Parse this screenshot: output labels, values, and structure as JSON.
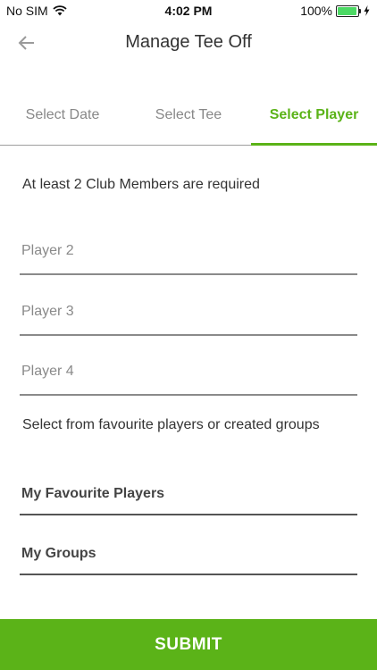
{
  "status_bar": {
    "carrier": "No SIM",
    "time": "4:02 PM",
    "battery": "100%",
    "battery_color": "#4cd964"
  },
  "nav": {
    "title": "Manage Tee Off",
    "back_icon": "arrow-left-icon"
  },
  "tabs": [
    {
      "label": "Select Date",
      "active": false
    },
    {
      "label": "Select Tee",
      "active": false
    },
    {
      "label": "Select Player",
      "active": true
    }
  ],
  "form": {
    "requirement_text": "At least 2 Club Members are required",
    "players": [
      {
        "placeholder": "Player 2"
      },
      {
        "placeholder": "Player 3"
      },
      {
        "placeholder": "Player 4"
      }
    ],
    "favourites_text": "Select from favourite players or created groups",
    "selectors": [
      {
        "label": "My Favourite Players"
      },
      {
        "label": "My Groups"
      }
    ]
  },
  "submit_label": "SUBMIT",
  "colors": {
    "accent": "#5bb318"
  }
}
